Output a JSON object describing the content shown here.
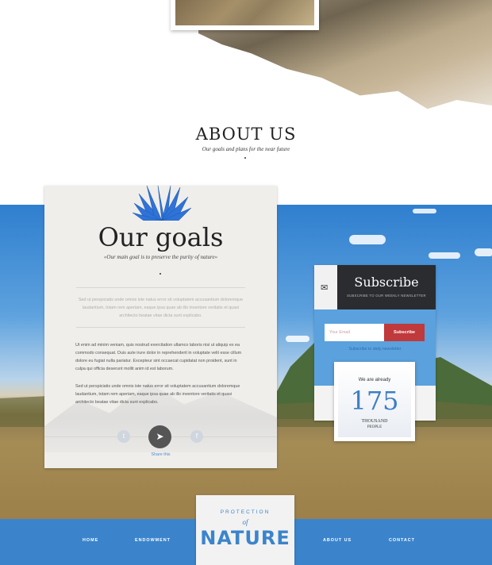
{
  "about": {
    "title": "ABOUT US",
    "subtitle": "Our goals and plans for the near future"
  },
  "goals": {
    "title": "Our goals",
    "subtitle": "«Our main goal is to preserve the purity of nature»",
    "intro": "Sed ut perspiciatis unde omnis iste natus error sit voluptatem accusantium doloremque laudantium, totam rem aperiam, eaque ipsa quae ab illo inventore veritatis et quasi architecto beatae vitae dicta sunt explicabo.",
    "paragraph1": "Ut enim ad minim veniam, quis nostrud exercitation ullamco laboris nisi ut aliquip ex ea commodo consequat. Duis aute irure dolor in reprehenderit in voluptate velit esse cillum dolore eu fugiat nulla pariatur. Excepteur sint occaecat cupidatat non proident, sunt in culpa qui officia deserunt mollit anim id est laborum.",
    "paragraph2": "Sed ut perspiciatis unde omnis iste natus error sit voluptatem accusantium doloremque laudantium, totam rem aperiam, eaque ipsa quae ab illo inventore veritatis et quasi architecto beatae vitae dicta sunt explicabo.",
    "share_label": "Share this"
  },
  "subscribe": {
    "title": "Subscribe",
    "tagline": "SUBSCRIBE TO OUR WEEKLY NEWSLETTER",
    "email_placeholder": "Your Email",
    "button_label": "Subscribe",
    "daily_link": "Subscribe to daily newsletter",
    "already_label": "We are already",
    "count": "175",
    "thousand_label": "THOUSAND",
    "people_label": "PEOPLE"
  },
  "nav": {
    "items": [
      "HOME",
      "ENDOWMENT",
      "ABOUT US",
      "CONTACT"
    ]
  },
  "logo": {
    "top": "PROTECTION",
    "of": "of",
    "main": "NATURE"
  },
  "colors": {
    "accent_blue": "#3b84cc",
    "subscribe_red": "#c0393b",
    "dark_header": "#2a2c30"
  },
  "icons": [
    "twitter-icon",
    "send-icon",
    "facebook-icon",
    "envelope-icon",
    "flower-icon"
  ]
}
